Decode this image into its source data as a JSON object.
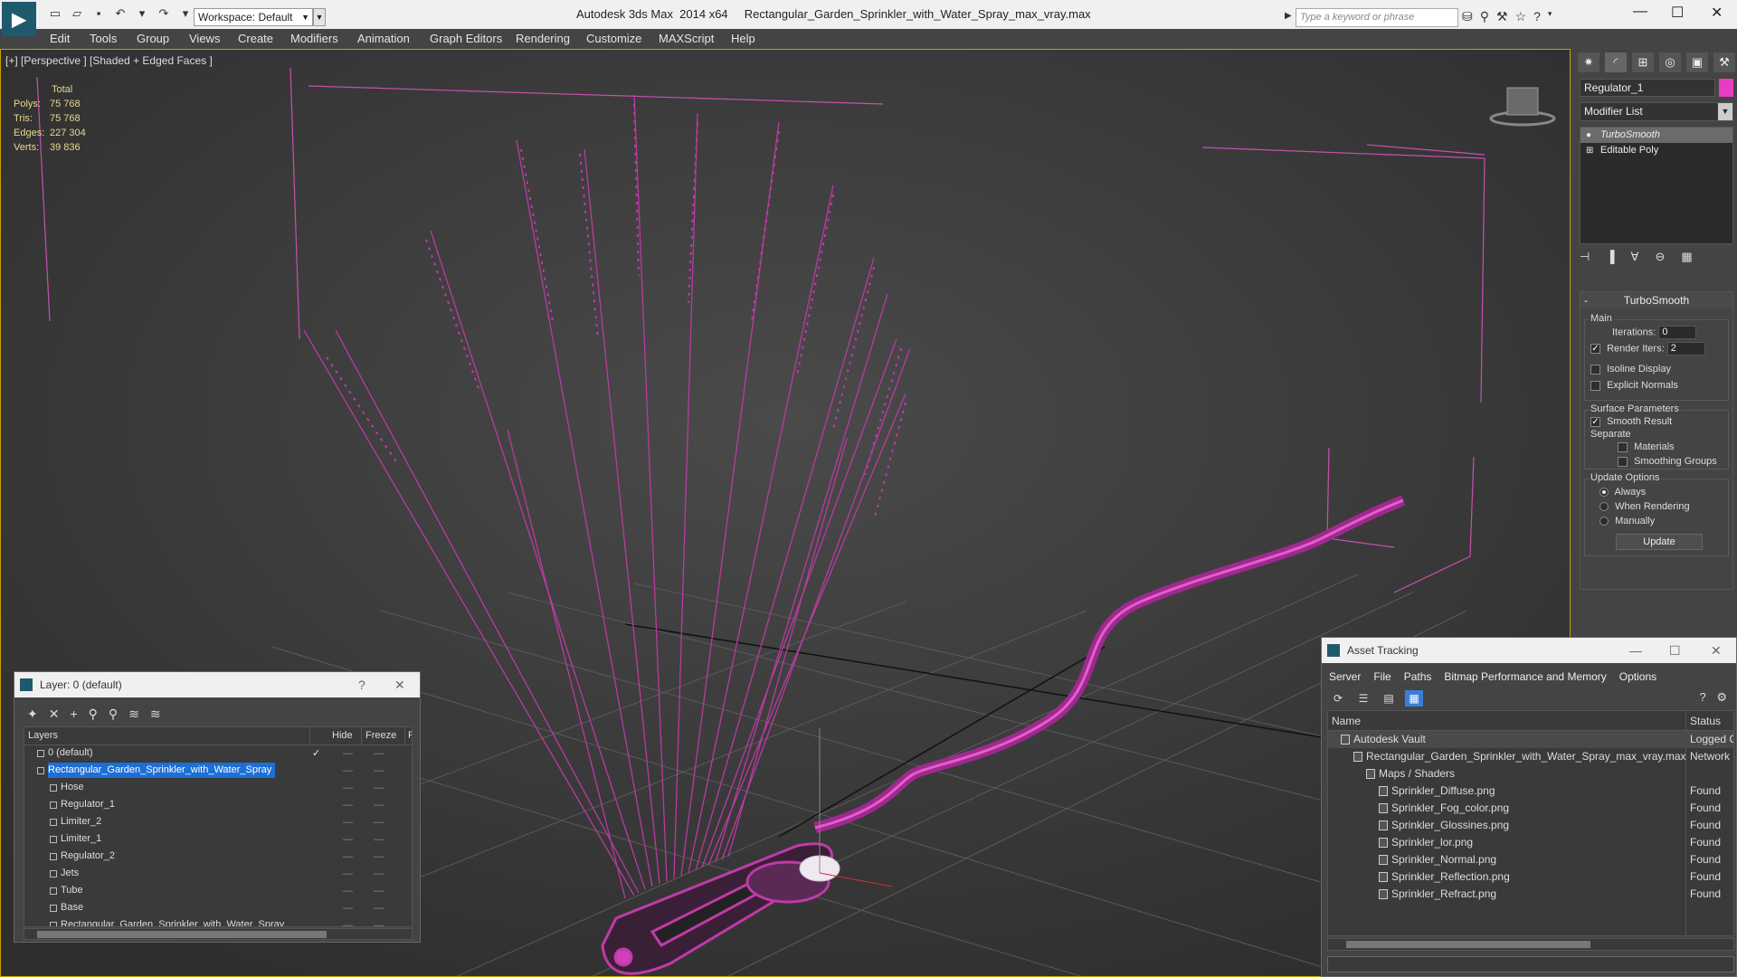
{
  "app": {
    "title": "Autodesk 3ds Max  2014 x64     Rectangular_Garden_Sprinkler_with_Water_Spray_max_vray.max",
    "workspace_label": "Workspace: Default",
    "search_placeholder": "Type a keyword or phrase"
  },
  "menu": [
    "Edit",
    "Tools",
    "Group",
    "Views",
    "Create",
    "Modifiers",
    "Animation",
    "Graph Editors",
    "Rendering",
    "Customize",
    "MAXScript",
    "Help"
  ],
  "viewport": {
    "label": "[+] [Perspective ] [Shaded + Edged Faces ]",
    "stats": {
      "header": "Total",
      "rows": [
        {
          "k": "Polys:",
          "v": "75 768"
        },
        {
          "k": "Tris:",
          "v": "75 768"
        },
        {
          "k": "Edges:",
          "v": "227 304"
        },
        {
          "k": "Verts:",
          "v": "39 836"
        }
      ]
    },
    "wire_color": "#c832b4"
  },
  "command_panel": {
    "object_name": "Regulator_1",
    "object_color": "#e83cc4",
    "modifier_list": "Modifier List",
    "stack": [
      {
        "label": "TurboSmooth",
        "selected": true
      },
      {
        "label": "Editable Poly",
        "selected": false
      }
    ],
    "rollout": {
      "title": "TurboSmooth",
      "main_group": "Main",
      "iterations_label": "Iterations:",
      "iterations_value": "0",
      "render_iters_label": "Render Iters:",
      "render_iters_value": "2",
      "isoline": "Isoline Display",
      "explicit_normals": "Explicit Normals",
      "surface_group": "Surface Parameters",
      "smooth_result": "Smooth Result",
      "separate": "Separate",
      "materials": "Materials",
      "smoothing_groups": "Smoothing Groups",
      "update_group": "Update Options",
      "always": "Always",
      "when_rendering": "When Rendering",
      "manually": "Manually",
      "update_btn": "Update"
    }
  },
  "layer_dialog": {
    "title": "Layer: 0 (default)",
    "help": "?",
    "close": "✕",
    "col_layers": "Layers",
    "col_hide": "Hide",
    "col_freeze": "Freeze",
    "col_r": "R",
    "rows": [
      {
        "name": "0 (default)",
        "indent": 1,
        "check": "✓",
        "selected": false
      },
      {
        "name": "Rectangular_Garden_Sprinkler_with_Water_Spray",
        "indent": 1,
        "check": "",
        "selected": true
      },
      {
        "name": "Hose",
        "indent": 2,
        "check": "",
        "selected": false
      },
      {
        "name": "Regulator_1",
        "indent": 2,
        "check": "",
        "selected": false
      },
      {
        "name": "Limiter_2",
        "indent": 2,
        "check": "",
        "selected": false
      },
      {
        "name": "Limiter_1",
        "indent": 2,
        "check": "",
        "selected": false
      },
      {
        "name": "Regulator_2",
        "indent": 2,
        "check": "",
        "selected": false
      },
      {
        "name": "Jets",
        "indent": 2,
        "check": "",
        "selected": false
      },
      {
        "name": "Tube",
        "indent": 2,
        "check": "",
        "selected": false
      },
      {
        "name": "Base",
        "indent": 2,
        "check": "",
        "selected": false
      },
      {
        "name": "Rectangular_Garden_Sprinkler_with_Water_Spray",
        "indent": 2,
        "check": "",
        "selected": false
      }
    ]
  },
  "asset_dialog": {
    "title": "Asset Tracking",
    "menu": [
      "Server",
      "File",
      "Paths",
      "Bitmap Performance and Memory",
      "Options"
    ],
    "col_name": "Name",
    "col_status": "Status",
    "rows": [
      {
        "name": "Autodesk Vault",
        "status": "Logged C",
        "indent": 1
      },
      {
        "name": "Rectangular_Garden_Sprinkler_with_Water_Spray_max_vray.max",
        "status": "Network",
        "indent": 2
      },
      {
        "name": "Maps / Shaders",
        "status": "",
        "indent": 3
      },
      {
        "name": "Sprinkler_Diffuse.png",
        "status": "Found",
        "indent": 4
      },
      {
        "name": "Sprinkler_Fog_color.png",
        "status": "Found",
        "indent": 4
      },
      {
        "name": "Sprinkler_Glossines.png",
        "status": "Found",
        "indent": 4
      },
      {
        "name": "Sprinkler_lor.png",
        "status": "Found",
        "indent": 4
      },
      {
        "name": "Sprinkler_Normal.png",
        "status": "Found",
        "indent": 4
      },
      {
        "name": "Sprinkler_Reflection.png",
        "status": "Found",
        "indent": 4
      },
      {
        "name": "Sprinkler_Refract.png",
        "status": "Found",
        "indent": 4
      }
    ]
  }
}
